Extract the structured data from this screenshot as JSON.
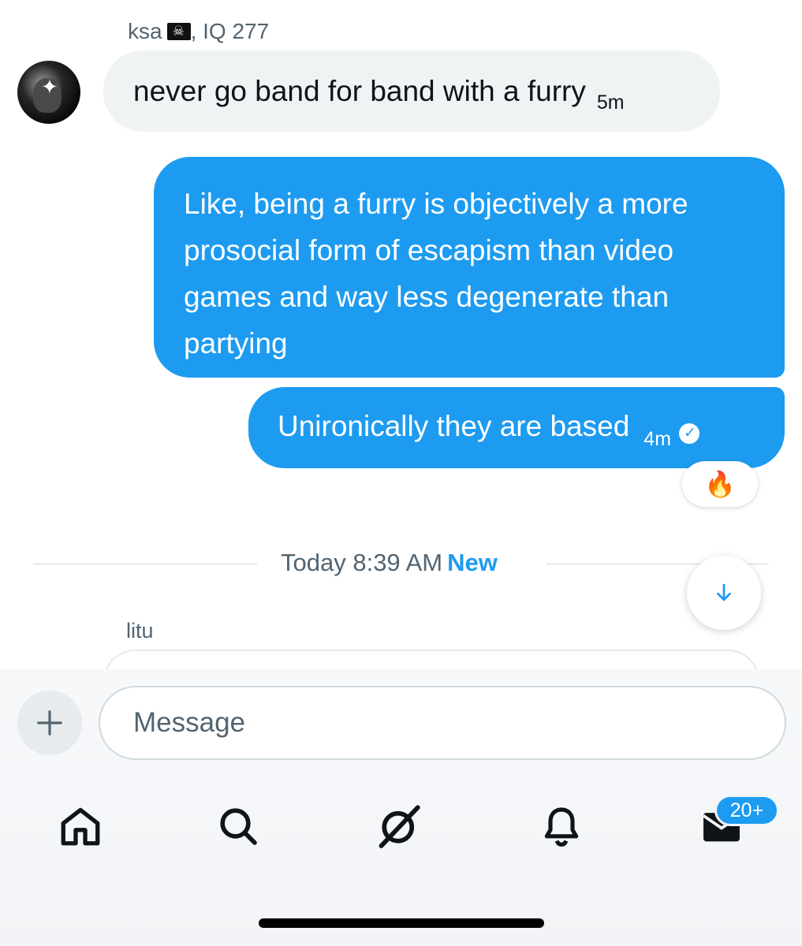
{
  "incoming": {
    "sender_name": "ksa",
    "sender_suffix": ", IQ 277",
    "flag_icon": "pirate-flag-emoji",
    "text": "never go band for band with a furry",
    "time": "5m"
  },
  "outgoing": [
    {
      "text": "Like, being a furry is objectively a more prosocial form of escapism than video games and way less degenerate than partying"
    },
    {
      "text": "Unironically they are based",
      "time": "4m",
      "status_icon": "read-check-icon"
    }
  ],
  "reaction": {
    "emoji": "🔥"
  },
  "divider": {
    "label": "Today 8:39 AM",
    "new_label": "New"
  },
  "next_sender": "litu",
  "composer": {
    "placeholder": "Message"
  },
  "nav": {
    "items": [
      "home-icon",
      "search-icon",
      "grok-icon",
      "notifications-icon",
      "messages-icon"
    ],
    "messages_badge": "20+"
  },
  "colors": {
    "accent": "#1d9bf0",
    "incoming_bubble": "#eff3f4",
    "muted_text": "#536471"
  }
}
